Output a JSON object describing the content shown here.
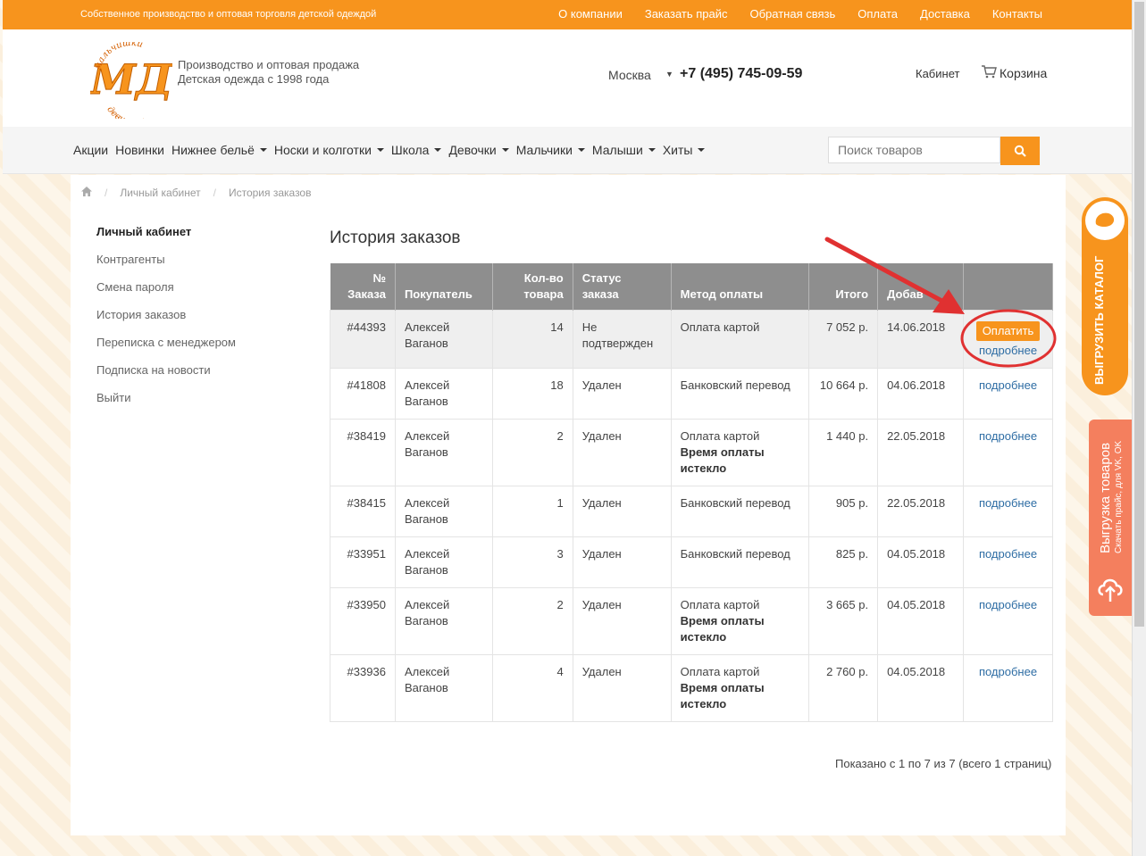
{
  "topbar": {
    "tagline": "Собственное производство и оптовая торговля детской одеждой",
    "links": [
      "О компании",
      "Заказать прайс",
      "Обратная связь",
      "Оплата",
      "Доставка",
      "Контакты"
    ]
  },
  "header": {
    "logo_letters": "МД",
    "logo_top": "мальчишки",
    "logo_bottom": "девчонки",
    "tagline_line1": "Производство и оптовая продажа",
    "tagline_line2": "Детская одежда с 1998 года",
    "city": "Москва",
    "phone": "+7 (495) 745-09-59",
    "cabinet": "Кабинет",
    "cart": "Корзина"
  },
  "nav": {
    "items": [
      {
        "label": "Акции",
        "dropdown": false
      },
      {
        "label": "Новинки",
        "dropdown": false
      },
      {
        "label": "Нижнее бельё",
        "dropdown": true
      },
      {
        "label": "Носки и колготки",
        "dropdown": true
      },
      {
        "label": "Школа",
        "dropdown": true
      },
      {
        "label": "Девочки",
        "dropdown": true
      },
      {
        "label": "Мальчики",
        "dropdown": true
      },
      {
        "label": "Малыши",
        "dropdown": true
      },
      {
        "label": "Хиты",
        "dropdown": true
      }
    ],
    "search_placeholder": "Поиск товаров"
  },
  "breadcrumb": [
    "Личный кабинет",
    "История заказов"
  ],
  "sidebar": {
    "title": "Личный кабинет",
    "items": [
      "Контрагенты",
      "Смена пароля",
      "История заказов",
      "Переписка с менеджером",
      "Подписка на новости",
      "Выйти"
    ]
  },
  "page_title": "История заказов",
  "table": {
    "headers": {
      "num1": "№",
      "num2": "Заказа",
      "buyer": "Покупатель",
      "qty1": "Кол-во",
      "qty2": "товара",
      "status1": "Статус",
      "status2": "заказа",
      "method": "Метод оплаты",
      "total": "Итого",
      "added": "Добав"
    },
    "rows": [
      {
        "num": "#44393",
        "buyer1": "Алексей",
        "buyer2": "Ваганов",
        "qty": "14",
        "status1": "Не",
        "status2": "подтвержден",
        "method": "Оплата картой",
        "note1": "",
        "note2": "",
        "total": "7 052 р.",
        "date": "14.06.2018",
        "pay": "Оплатить",
        "more": "подробнее"
      },
      {
        "num": "#41808",
        "buyer1": "Алексей",
        "buyer2": "Ваганов",
        "qty": "18",
        "status1": "Удален",
        "status2": "",
        "method": "Банковский перевод",
        "note1": "",
        "note2": "",
        "total": "10 664 р.",
        "date": "04.06.2018",
        "pay": "",
        "more": "подробнее"
      },
      {
        "num": "#38419",
        "buyer1": "Алексей",
        "buyer2": "Ваганов",
        "qty": "2",
        "status1": "Удален",
        "status2": "",
        "method": "Оплата картой",
        "note1": "Время оплаты",
        "note2": "истекло",
        "total": "1 440 р.",
        "date": "22.05.2018",
        "pay": "",
        "more": "подробнее"
      },
      {
        "num": "#38415",
        "buyer1": "Алексей",
        "buyer2": "Ваганов",
        "qty": "1",
        "status1": "Удален",
        "status2": "",
        "method": "Банковский перевод",
        "note1": "",
        "note2": "",
        "total": "905 р.",
        "date": "22.05.2018",
        "pay": "",
        "more": "подробнее"
      },
      {
        "num": "#33951",
        "buyer1": "Алексей",
        "buyer2": "Ваганов",
        "qty": "3",
        "status1": "Удален",
        "status2": "",
        "method": "Банковский перевод",
        "note1": "",
        "note2": "",
        "total": "825 р.",
        "date": "04.05.2018",
        "pay": "",
        "more": "подробнее"
      },
      {
        "num": "#33950",
        "buyer1": "Алексей",
        "buyer2": "Ваганов",
        "qty": "2",
        "status1": "Удален",
        "status2": "",
        "method": "Оплата картой",
        "note1": "Время оплаты",
        "note2": "истекло",
        "total": "3 665 р.",
        "date": "04.05.2018",
        "pay": "",
        "more": "подробнее"
      },
      {
        "num": "#33936",
        "buyer1": "Алексей",
        "buyer2": "Ваганов",
        "qty": "4",
        "status1": "Удален",
        "status2": "",
        "method": "Оплата картой",
        "note1": "Время оплаты",
        "note2": "истекло",
        "total": "2 760 р.",
        "date": "04.05.2018",
        "pay": "",
        "more": "подробнее"
      }
    ]
  },
  "pager": "Показано с 1 по 7 из 7 (всего 1 страниц)",
  "side_tabs": {
    "catalog": "ВЫГРУЗИТЬ КАТАЛОГ",
    "upload_title": "Выгрузка товаров",
    "upload_sub": "Скачать прайс, для VK, OK"
  },
  "colors": {
    "accent": "#f7941d",
    "table_header": "#8e8e8e",
    "link": "#2e6da4",
    "annotation": "#e03131"
  },
  "icons": [
    "home-icon",
    "cart-icon",
    "search-icon",
    "cloud-upload-icon"
  ]
}
